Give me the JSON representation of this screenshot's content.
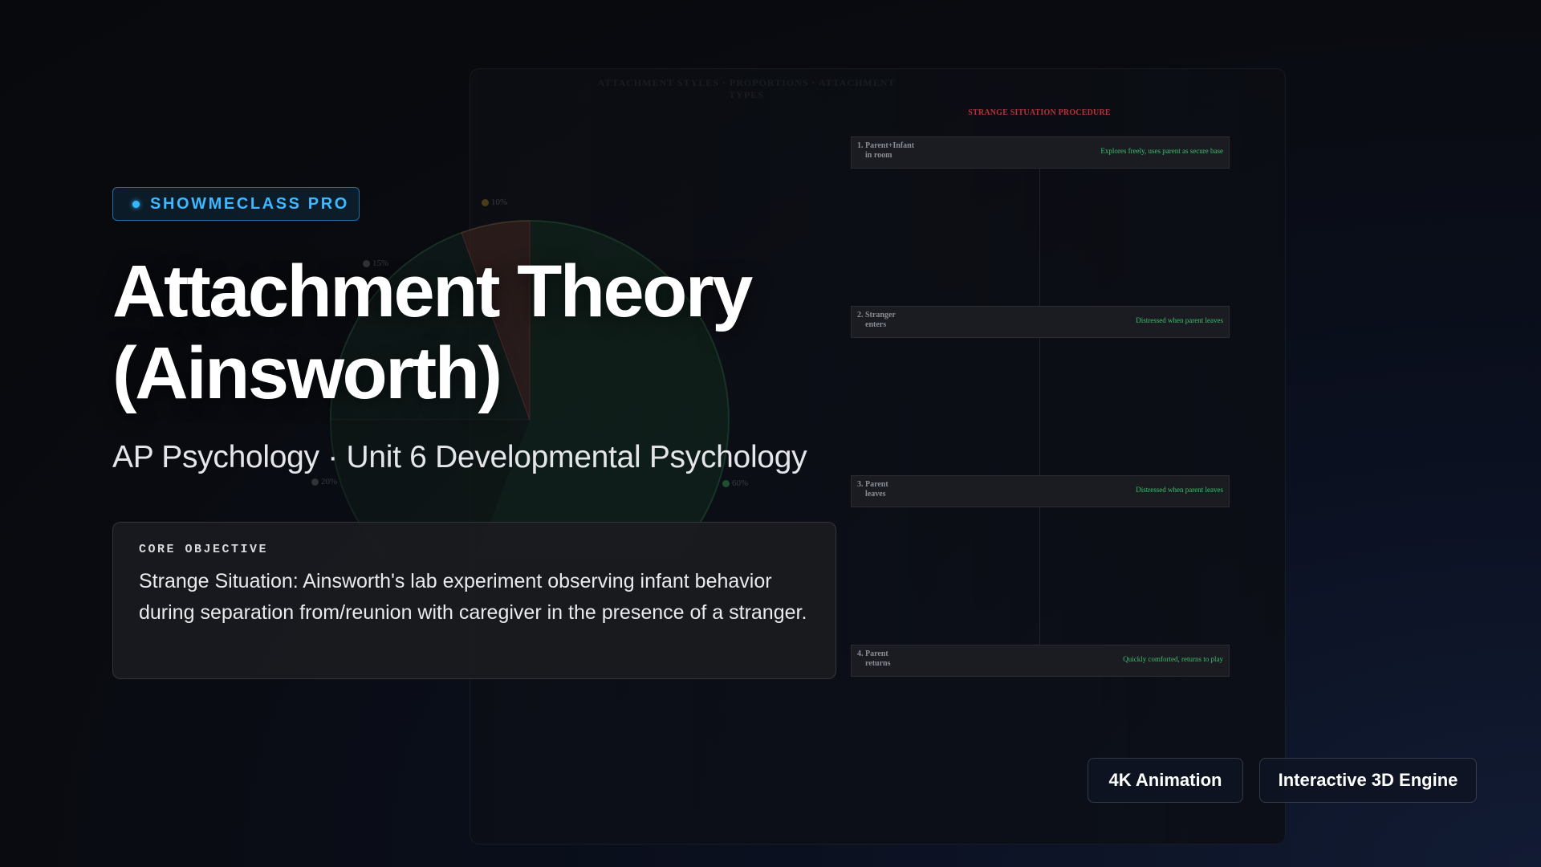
{
  "background": {
    "panel_heading": "ATTACHMENT STYLES · PROPORTIONS · ATTACHMENT TYPES",
    "pie_labels": [
      "10%",
      "15%",
      "20%",
      "60%"
    ],
    "pie_colors": [
      "#b8323a",
      "#2f7a45",
      "#8a6a1a",
      "#2f5a2f"
    ],
    "procedure": {
      "title": "STRANGE SITUATION PROCEDURE",
      "steps": [
        {
          "label": "1. Parent+Infant\n    in room",
          "note": "Explores freely, uses parent as secure base"
        },
        {
          "label": "2. Stranger\n    enters",
          "note": "Distressed when parent leaves"
        },
        {
          "label": "3. Parent\n    leaves",
          "note": "Distressed when parent leaves"
        },
        {
          "label": "4. Parent\n    returns",
          "note": "Quickly comforted, returns to play"
        }
      ]
    }
  },
  "badge": {
    "text": "SHOWMECLASS PRO"
  },
  "title": {
    "line1": "Attachment Theory",
    "line2": "(Ainsworth)"
  },
  "subtitle": "AP Psychology · Unit 6 Developmental Psychology",
  "objective": {
    "label": "CORE OBJECTIVE",
    "text": "Strange Situation: Ainsworth's lab experiment observing infant behavior during separation from/reunion with caregiver in the presence of a stranger."
  },
  "features": {
    "animation": "4K Animation",
    "engine": "Interactive 3D Engine"
  },
  "colors": {
    "accent": "#36b6ff",
    "procedure_title": "#b8323a",
    "procedure_note": "#3fbf6a"
  }
}
